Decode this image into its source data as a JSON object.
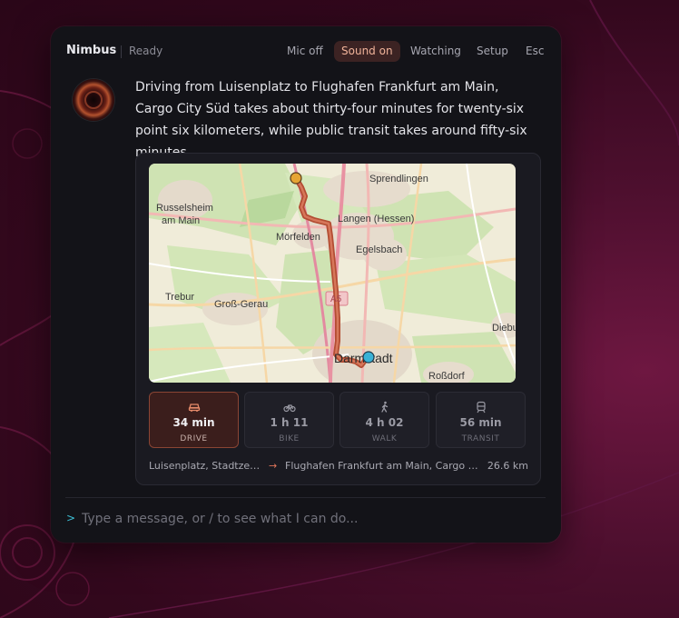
{
  "header": {
    "app_name": "Nimbus",
    "status": "Ready",
    "buttons": [
      {
        "label": "Mic off",
        "active": false
      },
      {
        "label": "Sound on",
        "active": true
      },
      {
        "label": "Watching",
        "active": false
      },
      {
        "label": "Setup",
        "active": false
      },
      {
        "label": "Esc",
        "active": false
      }
    ]
  },
  "assistant": {
    "message": "Driving from Luisenplatz to Flughafen Frankfurt am Main, Cargo City Süd takes about thirty-four minutes for twenty-six point six kilometers, while public transit takes around fifty-six minutes."
  },
  "map": {
    "labels": {
      "sprendlingen": "Sprendlingen",
      "russelsheim_1": "Russelsheim",
      "russelsheim_2": "am Main",
      "langen": "Langen (Hessen)",
      "morfelden": "Mörfelden",
      "egelsbach": "Egelsbach",
      "trebur": "Trebur",
      "gross_gerau": "Groß-Gerau",
      "a5": "A5",
      "darmstadt": "Darmstadt",
      "dieburg": "Diebu",
      "rossdorf": "Roßdorf"
    },
    "start_color": "#e6a534",
    "end_color": "#3ab2d6",
    "route_color": "#c1583a"
  },
  "modes": [
    {
      "id": "drive",
      "icon": "car-icon",
      "time": "34 min",
      "label": "DRIVE",
      "active": true
    },
    {
      "id": "bike",
      "icon": "bike-icon",
      "time": "1 h 11",
      "label": "BIKE",
      "active": false
    },
    {
      "id": "walk",
      "icon": "walk-icon",
      "time": "4 h 02",
      "label": "WALK",
      "active": false
    },
    {
      "id": "transit",
      "icon": "train-icon",
      "time": "56 min",
      "label": "TRANSIT",
      "active": false
    }
  ],
  "route": {
    "from": "Luisenplatz, Stadtzentrum, Darmstadt",
    "arrow": "→",
    "to": "Flughafen Frankfurt am Main, Cargo City Süd",
    "distance": "26.6 km"
  },
  "input": {
    "prompt_symbol": ">",
    "placeholder": "Type a message, or / to see what I can do..."
  }
}
